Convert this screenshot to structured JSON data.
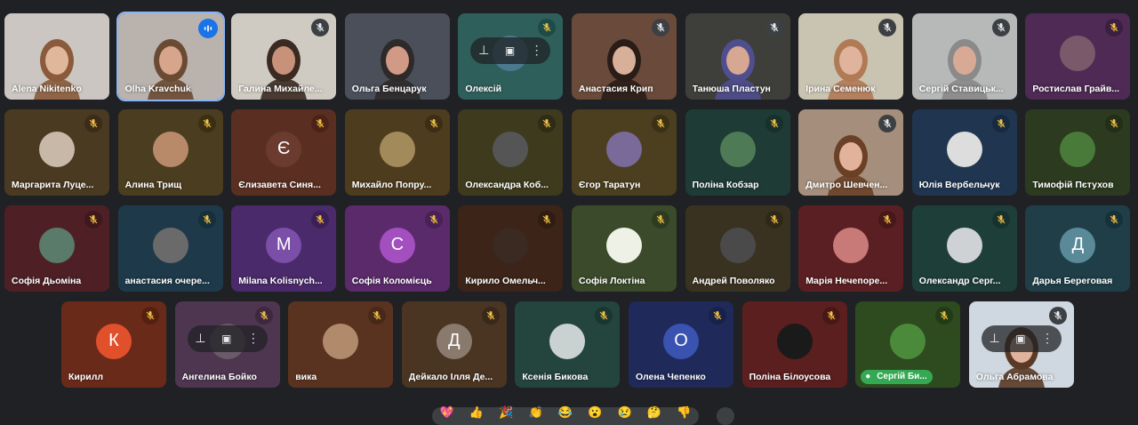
{
  "colors": {
    "background": "#202124",
    "active_outline": "#8ab4f8"
  },
  "participants": [
    {
      "name": "Alena Nikitenko",
      "type": "video",
      "bg": "#cbc6c2",
      "skin": "#e0b79a",
      "hair": "#8a5a3a",
      "mic": "none"
    },
    {
      "name": "Olha Kravchuk",
      "type": "video",
      "bg": "#b9b2ad",
      "skin": "#d7a58c",
      "hair": "#6b4a33",
      "mic": "speaking",
      "active": true
    },
    {
      "name": "Галина Михайле...",
      "type": "video",
      "bg": "#cfcbc2",
      "skin": "#c8927a",
      "hair": "#3a2a22",
      "mic": "muted",
      "mic_color": "#3c4043"
    },
    {
      "name": "Ольга Бенцарук",
      "type": "video",
      "bg": "#4a4f5a",
      "skin": "#d09a86",
      "hair": "#2e2a2a",
      "mic": "none"
    },
    {
      "name": "Олексій",
      "type": "avatar-hover",
      "bg": "#2f5f5b",
      "avatar_color": "#4b7a90",
      "mic": "muted",
      "mic_color": "#1e4a47"
    },
    {
      "name": "Анастасия Крип",
      "type": "video",
      "bg": "#6a4a3a",
      "skin": "#d8b09a",
      "hair": "#2a1d18",
      "mic": "muted",
      "mic_color": "#3c4043"
    },
    {
      "name": "Танюша Пластун",
      "type": "video",
      "bg": "#3e3f3a",
      "skin": "#d6a792",
      "hair": "#4f4e8e",
      "mic": "muted",
      "mic_color": "#3c4043"
    },
    {
      "name": "Ірина Семенюк",
      "type": "video",
      "bg": "#c9c4b2",
      "skin": "#e0b39c",
      "hair": "#b07a55",
      "mic": "muted",
      "mic_color": "#3c4043"
    },
    {
      "name": "Сергій Ставицьк...",
      "type": "video",
      "bg": "#b7b9b8",
      "skin": "#d8aa95",
      "hair": "#8a8a8a",
      "mic": "muted",
      "mic_color": "#3c4043"
    },
    {
      "name": "Ростислав Грайв...",
      "type": "avatar",
      "bg": "#4e2a55",
      "avatar_color": "#7a5a6a",
      "mic": "muted",
      "mic_color": "#3a1f40"
    },
    {
      "name": "Маргарита Луце...",
      "type": "avatar",
      "bg": "#4a3a22",
      "avatar_color": "#c8b8a8",
      "mic": "muted",
      "mic_color": "#3a2c18"
    },
    {
      "name": "Алина Трищ",
      "type": "avatar",
      "bg": "#4b3d1f",
      "avatar_color": "#b88a6a",
      "mic": "muted",
      "mic_color": "#3a2f15"
    },
    {
      "name": "Єлизавета Синя...",
      "type": "letter",
      "letter": "Є",
      "bg": "#5a2f22",
      "avatar_color": "#6a3b2e",
      "mic": "muted",
      "mic_color": "#4a2418"
    },
    {
      "name": "Михайло Попру...",
      "type": "avatar",
      "bg": "#4e3c1e",
      "avatar_color": "#a38a5a",
      "mic": "muted",
      "mic_color": "#3c2e16"
    },
    {
      "name": "Олександра Коб...",
      "type": "avatar",
      "bg": "#3d3a1e",
      "avatar_color": "#555555",
      "mic": "muted",
      "mic_color": "#2f2c16"
    },
    {
      "name": "Єгор Таратун",
      "type": "avatar",
      "bg": "#4b3f20",
      "avatar_color": "#7a6a9a",
      "mic": "muted",
      "mic_color": "#3a3016"
    },
    {
      "name": "Поліна Кобзар",
      "type": "avatar",
      "bg": "#1f3b35",
      "avatar_color": "#4e7a55",
      "mic": "muted",
      "mic_color": "#173029"
    },
    {
      "name": "Дмитро Шевчен...",
      "type": "video",
      "bg": "#a58f7c",
      "skin": "#e2b29a",
      "hair": "#6a4026",
      "mic": "muted",
      "mic_color": "#3c4043"
    },
    {
      "name": "Юлія Вербельчук",
      "type": "avatar",
      "bg": "#1f3550",
      "avatar_color": "#dddddd",
      "mic": "muted",
      "mic_color": "#172a40"
    },
    {
      "name": "Тимофій Пєтухов",
      "type": "avatar",
      "bg": "#2c3a1f",
      "avatar_color": "#4a7a3a",
      "mic": "muted",
      "mic_color": "#222e17"
    },
    {
      "name": "Софія Дьоміна",
      "type": "avatar",
      "bg": "#4e2026",
      "avatar_color": "#5a7a6a",
      "mic": "muted",
      "mic_color": "#3e181d"
    },
    {
      "name": "анастасия очере...",
      "type": "avatar",
      "bg": "#1e3a4a",
      "avatar_color": "#6a6a6a",
      "mic": "muted",
      "mic_color": "#172e3b"
    },
    {
      "name": "Milana Kolisnych...",
      "type": "letter",
      "letter": "M",
      "bg": "#4a2a6a",
      "avatar_color": "#7b4ea8",
      "mic": "muted",
      "mic_color": "#3a2056"
    },
    {
      "name": "Софія Коломієць",
      "type": "letter",
      "letter": "С",
      "bg": "#5a2a6a",
      "avatar_color": "#a34fc0",
      "mic": "muted",
      "mic_color": "#482156"
    },
    {
      "name": "Кирило Омельч...",
      "type": "avatar",
      "bg": "#3c2418",
      "avatar_color": "#3a2a22",
      "mic": "muted",
      "mic_color": "#2f1c12"
    },
    {
      "name": "Софія Локтіна",
      "type": "avatar",
      "bg": "#3b4a2a",
      "avatar_color": "#eef2e6",
      "mic": "muted",
      "mic_color": "#2e3b20"
    },
    {
      "name": "Андрей Поволяко",
      "type": "avatar",
      "bg": "#3a3220",
      "avatar_color": "#4a4a4a",
      "mic": "muted",
      "mic_color": "#2e2818"
    },
    {
      "name": "Марія Нечепоре...",
      "type": "avatar",
      "bg": "#5a1f22",
      "avatar_color": "#c77a78",
      "mic": "muted",
      "mic_color": "#481719"
    },
    {
      "name": "Олександр Серг...",
      "type": "avatar",
      "bg": "#1e3e3a",
      "avatar_color": "#cfd2d4",
      "mic": "muted",
      "mic_color": "#17322e"
    },
    {
      "name": "Дарья Береговая",
      "type": "letter",
      "letter": "Д",
      "bg": "#1f3e48",
      "avatar_color": "#5a8a9a",
      "mic": "muted",
      "mic_color": "#17313a"
    },
    {
      "name": "Кирилл",
      "type": "letter",
      "letter": "К",
      "bg": "#6a2a1a",
      "avatar_color": "#e0502a",
      "mic": "muted",
      "mic_color": "#55200f"
    },
    {
      "name": "Ангелина Бойко",
      "type": "avatar-hover",
      "bg": "#4e3550",
      "avatar_color": "#6a5a6a",
      "mic": "muted",
      "mic_color": "#3e2840"
    },
    {
      "name": "вика",
      "type": "avatar",
      "bg": "#5a3320",
      "avatar_color": "#b08a6a",
      "mic": "muted",
      "mic_color": "#482818"
    },
    {
      "name": "Дейкало Ілля Де...",
      "type": "letter",
      "letter": "Д",
      "bg": "#4a3422",
      "avatar_color": "#8a7a6e",
      "mic": "muted",
      "mic_color": "#3a281a"
    },
    {
      "name": "Ксенія Бикова",
      "type": "avatar",
      "bg": "#24443e",
      "avatar_color": "#c9d2d0",
      "mic": "muted",
      "mic_color": "#1b3530"
    },
    {
      "name": "Олена Чепенко",
      "type": "letter",
      "letter": "О",
      "bg": "#1f2a5a",
      "avatar_color": "#3a52b0",
      "mic": "muted",
      "mic_color": "#182148"
    },
    {
      "name": "Поліна Білоусова",
      "type": "avatar",
      "bg": "#5a1f1e",
      "avatar_color": "#1a1a1a",
      "mic": "muted",
      "mic_color": "#481817"
    },
    {
      "name": "Сергій Би...",
      "type": "avatar-chip",
      "bg": "#2e4a1f",
      "avatar_color": "#4a8a3a",
      "mic": "muted",
      "mic_color": "#233a17"
    },
    {
      "name": "Ольга Абрамова",
      "type": "video-hover",
      "bg": "#cfd8e0",
      "skin": "#e0b49c",
      "hair": "#5a3a26",
      "mic": "muted",
      "mic_color": "#3c4043"
    }
  ],
  "reactions": [
    "💖",
    "👍",
    "🎉",
    "👏",
    "😂",
    "😮",
    "😢",
    "🤔",
    "👎"
  ]
}
